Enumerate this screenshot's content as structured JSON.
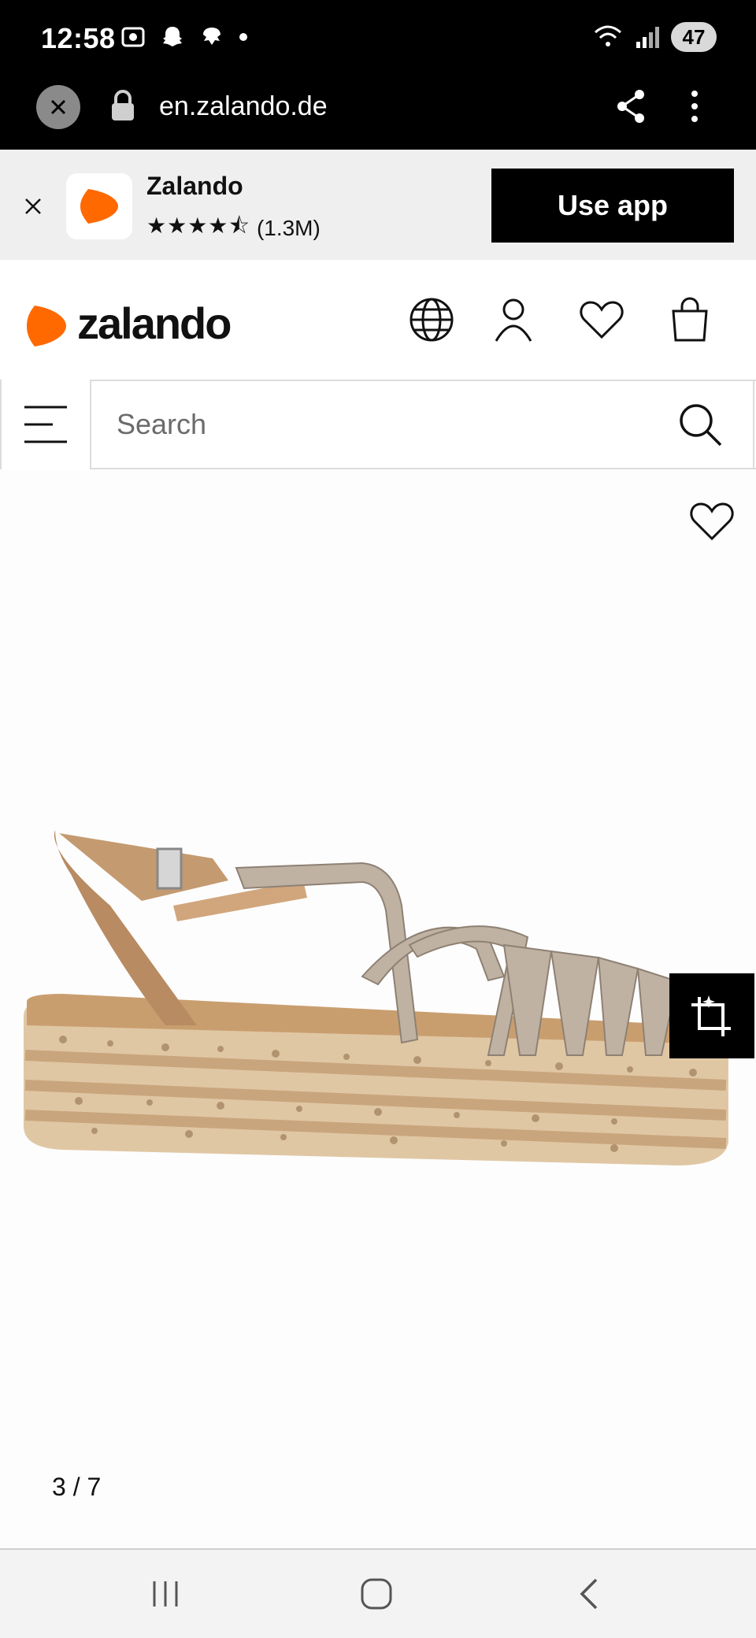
{
  "status_bar": {
    "time": "12:58",
    "battery": "47"
  },
  "browser": {
    "url": "en.zalando.de"
  },
  "app_banner": {
    "app_name": "Zalando",
    "stars": "★★★★⯪",
    "rating_count": "(1.3M)",
    "cta_label": "Use app"
  },
  "header": {
    "logo_text": "zalando",
    "brand_color": "#FF6900"
  },
  "search": {
    "placeholder": "Search"
  },
  "gallery": {
    "pager": "3 / 7"
  }
}
